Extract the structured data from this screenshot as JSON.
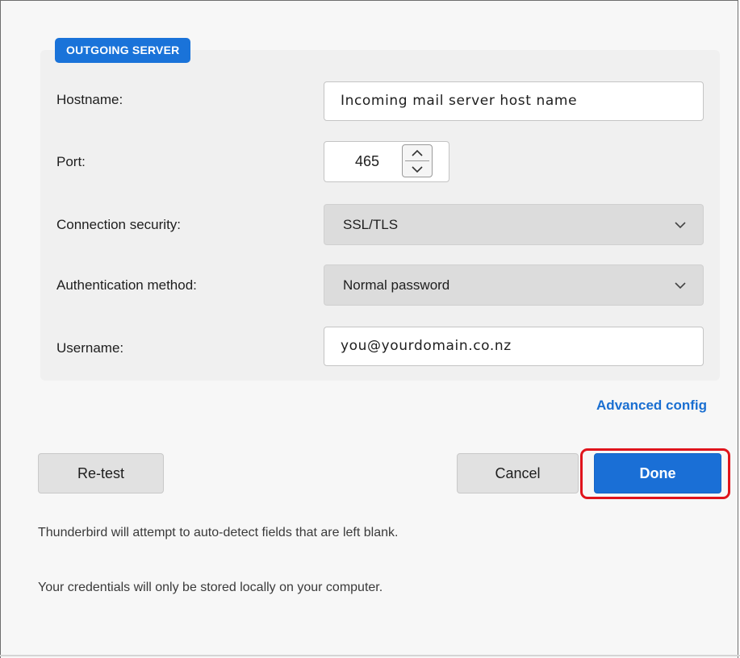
{
  "section": {
    "badge": "OUTGOING SERVER"
  },
  "fields": {
    "hostname": {
      "label": "Hostname:",
      "value": "Incoming mail server host name"
    },
    "port": {
      "label": "Port:",
      "value": "465"
    },
    "connection_security": {
      "label": "Connection security:",
      "value": "SSL/TLS"
    },
    "authentication_method": {
      "label": "Authentication method:",
      "value": "Normal password"
    },
    "username": {
      "label": "Username:",
      "value": "you@yourdomain.co.nz"
    }
  },
  "links": {
    "advanced_config": "Advanced config"
  },
  "buttons": {
    "retest": "Re-test",
    "cancel": "Cancel",
    "done": "Done"
  },
  "notes": {
    "auto_detect": "Thunderbird will attempt to auto-detect fields that are left blank.",
    "credentials": "Your credentials will only be stored locally on your computer."
  },
  "icons": {
    "chevron": "chevron-down-icon",
    "stepper_up": "chevron-up-icon",
    "stepper_down": "chevron-down-icon"
  },
  "colors": {
    "accent": "#1a6fd6",
    "badge": "#1a73d9",
    "highlight": "#e0141c"
  }
}
